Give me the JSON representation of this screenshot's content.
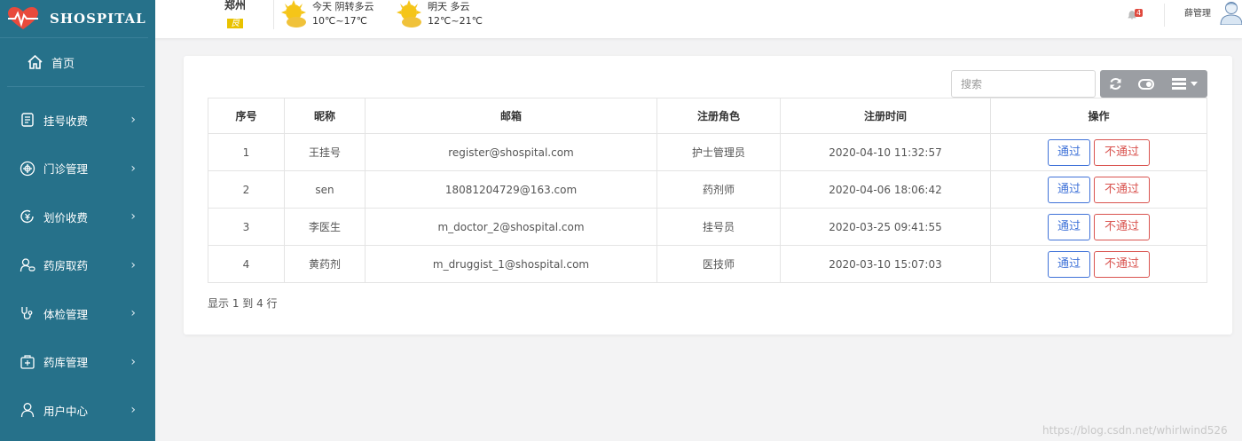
{
  "brand": {
    "name": "SHOSPITAL"
  },
  "sidebar": {
    "home_label": "首页",
    "items": [
      {
        "label": "挂号收费",
        "icon": "register-icon"
      },
      {
        "label": "门诊管理",
        "icon": "outpatient-icon"
      },
      {
        "label": "划价收费",
        "icon": "pricing-icon"
      },
      {
        "label": "药房取药",
        "icon": "pharmacy-icon"
      },
      {
        "label": "体检管理",
        "icon": "stethoscope-icon"
      },
      {
        "label": "药库管理",
        "icon": "medicine-store-icon"
      },
      {
        "label": "用户中心",
        "icon": "user-icon"
      }
    ]
  },
  "header": {
    "city": "郑州",
    "aqi": "良",
    "weather_today": {
      "label": "今天  阴转多云",
      "temp": "10℃~17℃"
    },
    "weather_tomorrow": {
      "label": "明天  多云",
      "temp": "12℃~21℃"
    },
    "notification_count": "4",
    "user_name": "薛管理"
  },
  "toolbar": {
    "search_placeholder": "搜索"
  },
  "table": {
    "headers": [
      "序号",
      "昵称",
      "邮箱",
      "注册角色",
      "注册时间",
      "操作"
    ],
    "rows": [
      {
        "no": "1",
        "nickname": "王挂号",
        "email": "register@shospital.com",
        "role": "护士管理员",
        "time": "2020-04-10 11:32:57"
      },
      {
        "no": "2",
        "nickname": "sen",
        "email": "18081204729@163.com",
        "role": "药剂师",
        "time": "2020-04-06 18:06:42"
      },
      {
        "no": "3",
        "nickname": "李医生",
        "email": "m_doctor_2@shospital.com",
        "role": "挂号员",
        "time": "2020-03-25 09:41:55"
      },
      {
        "no": "4",
        "nickname": "黄药剂",
        "email": "m_druggist_1@shospital.com",
        "role": "医技师",
        "time": "2020-03-10 15:07:03"
      }
    ],
    "approve_label": "通过",
    "reject_label": "不通过"
  },
  "pagination": {
    "summary": "显示 1 到 4 行"
  },
  "watermark": "https://blog.csdn.net/whirlwind526",
  "colors": {
    "sidebar_bg": "#26718a",
    "approve": "#3f72d8",
    "reject": "#d9534f",
    "toolbar_bg": "#9b9ea3"
  }
}
